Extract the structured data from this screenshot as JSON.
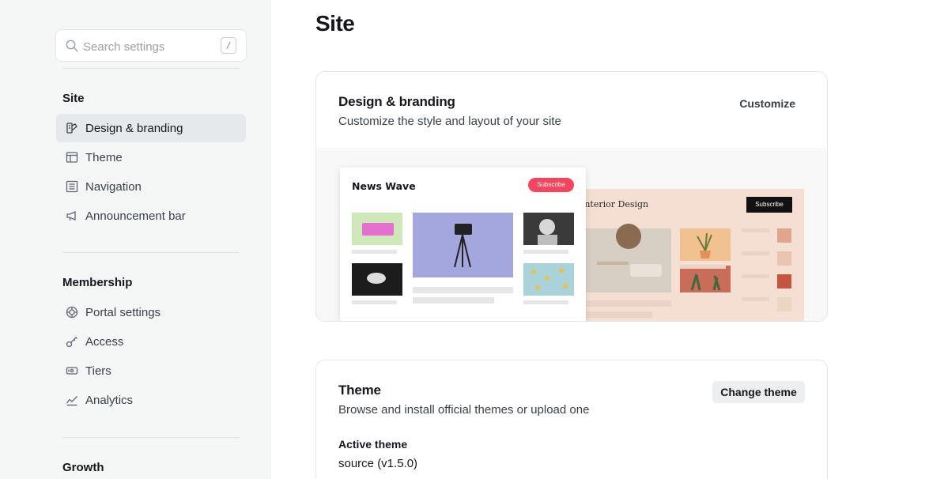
{
  "sidebar": {
    "search": {
      "placeholder": "Search settings",
      "shortcut": "/"
    },
    "groups": [
      {
        "title": "Site",
        "items": [
          {
            "label": "Design & branding",
            "icon": "brush-icon",
            "active": true
          },
          {
            "label": "Theme",
            "icon": "layout-icon"
          },
          {
            "label": "Navigation",
            "icon": "list-icon"
          },
          {
            "label": "Announcement bar",
            "icon": "megaphone-icon"
          }
        ]
      },
      {
        "title": "Membership",
        "items": [
          {
            "label": "Portal settings",
            "icon": "portal-icon"
          },
          {
            "label": "Access",
            "icon": "key-icon"
          },
          {
            "label": "Tiers",
            "icon": "ticket-icon"
          },
          {
            "label": "Analytics",
            "icon": "chart-icon"
          }
        ]
      },
      {
        "title": "Growth"
      }
    ]
  },
  "main": {
    "page_title": "Site",
    "design_card": {
      "title": "Design & branding",
      "description": "Customize the style and layout of your site",
      "action": "Customize",
      "preview_left": {
        "title": "News Wave",
        "button": "Subscribe"
      },
      "preview_right": {
        "title": "Interior Design",
        "button": "Subscribe"
      }
    },
    "theme_card": {
      "title": "Theme",
      "description": "Browse and install official themes or upload one",
      "action": "Change theme",
      "active_label": "Active theme",
      "active_value": "source (v1.5.0)"
    }
  },
  "colors": {
    "accent": "#f5445e",
    "sidebar_bg": "#f5f6f6",
    "active_bg": "#e6e9ec"
  }
}
